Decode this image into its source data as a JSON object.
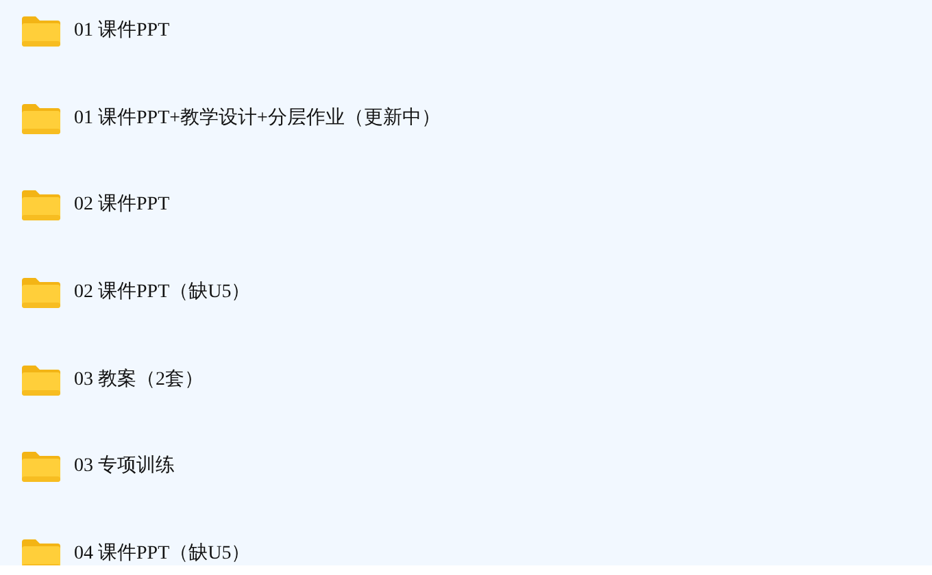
{
  "folders": [
    {
      "name": "01 课件PPT"
    },
    {
      "name": "01 课件PPT+教学设计+分层作业（更新中）"
    },
    {
      "name": "02 课件PPT"
    },
    {
      "name": "02 课件PPT（缺U5）"
    },
    {
      "name": "03 教案（2套）"
    },
    {
      "name": "03 专项训练"
    },
    {
      "name": "04 课件PPT（缺U5）"
    }
  ]
}
